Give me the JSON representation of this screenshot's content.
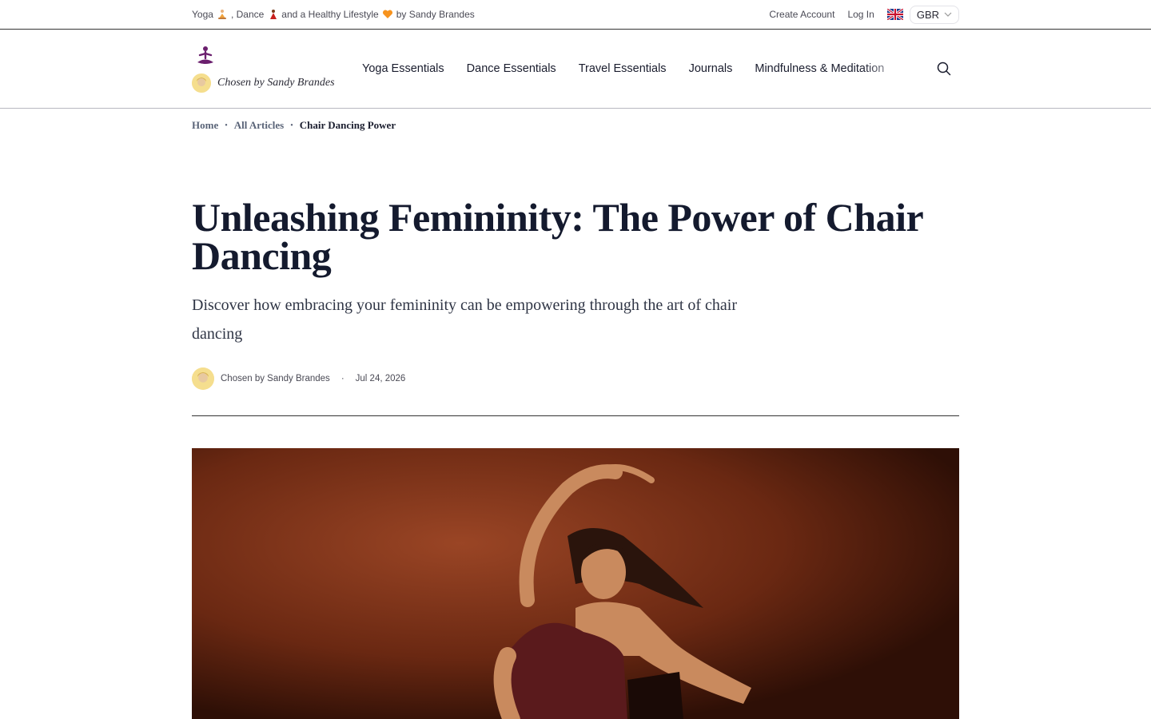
{
  "topbar": {
    "tagline_parts": [
      "Yoga",
      ", Dance",
      " and a Healthy Lifestyle",
      " by Sandy Brandes"
    ],
    "create_account": "Create Account",
    "log_in": "Log In",
    "currency": "GBR"
  },
  "header": {
    "brand_name": "Chosen by Sandy Brandes",
    "nav": [
      "Yoga Essentials",
      "Dance Essentials",
      "Travel Essentials",
      "Journals",
      "Mindfulness & Meditation"
    ]
  },
  "breadcrumb": {
    "home": "Home",
    "all_articles": "All Articles",
    "current": "Chair Dancing Power"
  },
  "article": {
    "title": "Unleashing Femininity: The Power of Chair Dancing",
    "subtitle": "Discover how embracing your femininity can be empowering through the art of chair dancing",
    "author": "Chosen by Sandy Brandes",
    "date": "Jul 24, 2026"
  },
  "colors": {
    "brand_purple": "#6b1f6e",
    "text_dark": "#141a2e",
    "hero_bg": "#6b2a14"
  }
}
